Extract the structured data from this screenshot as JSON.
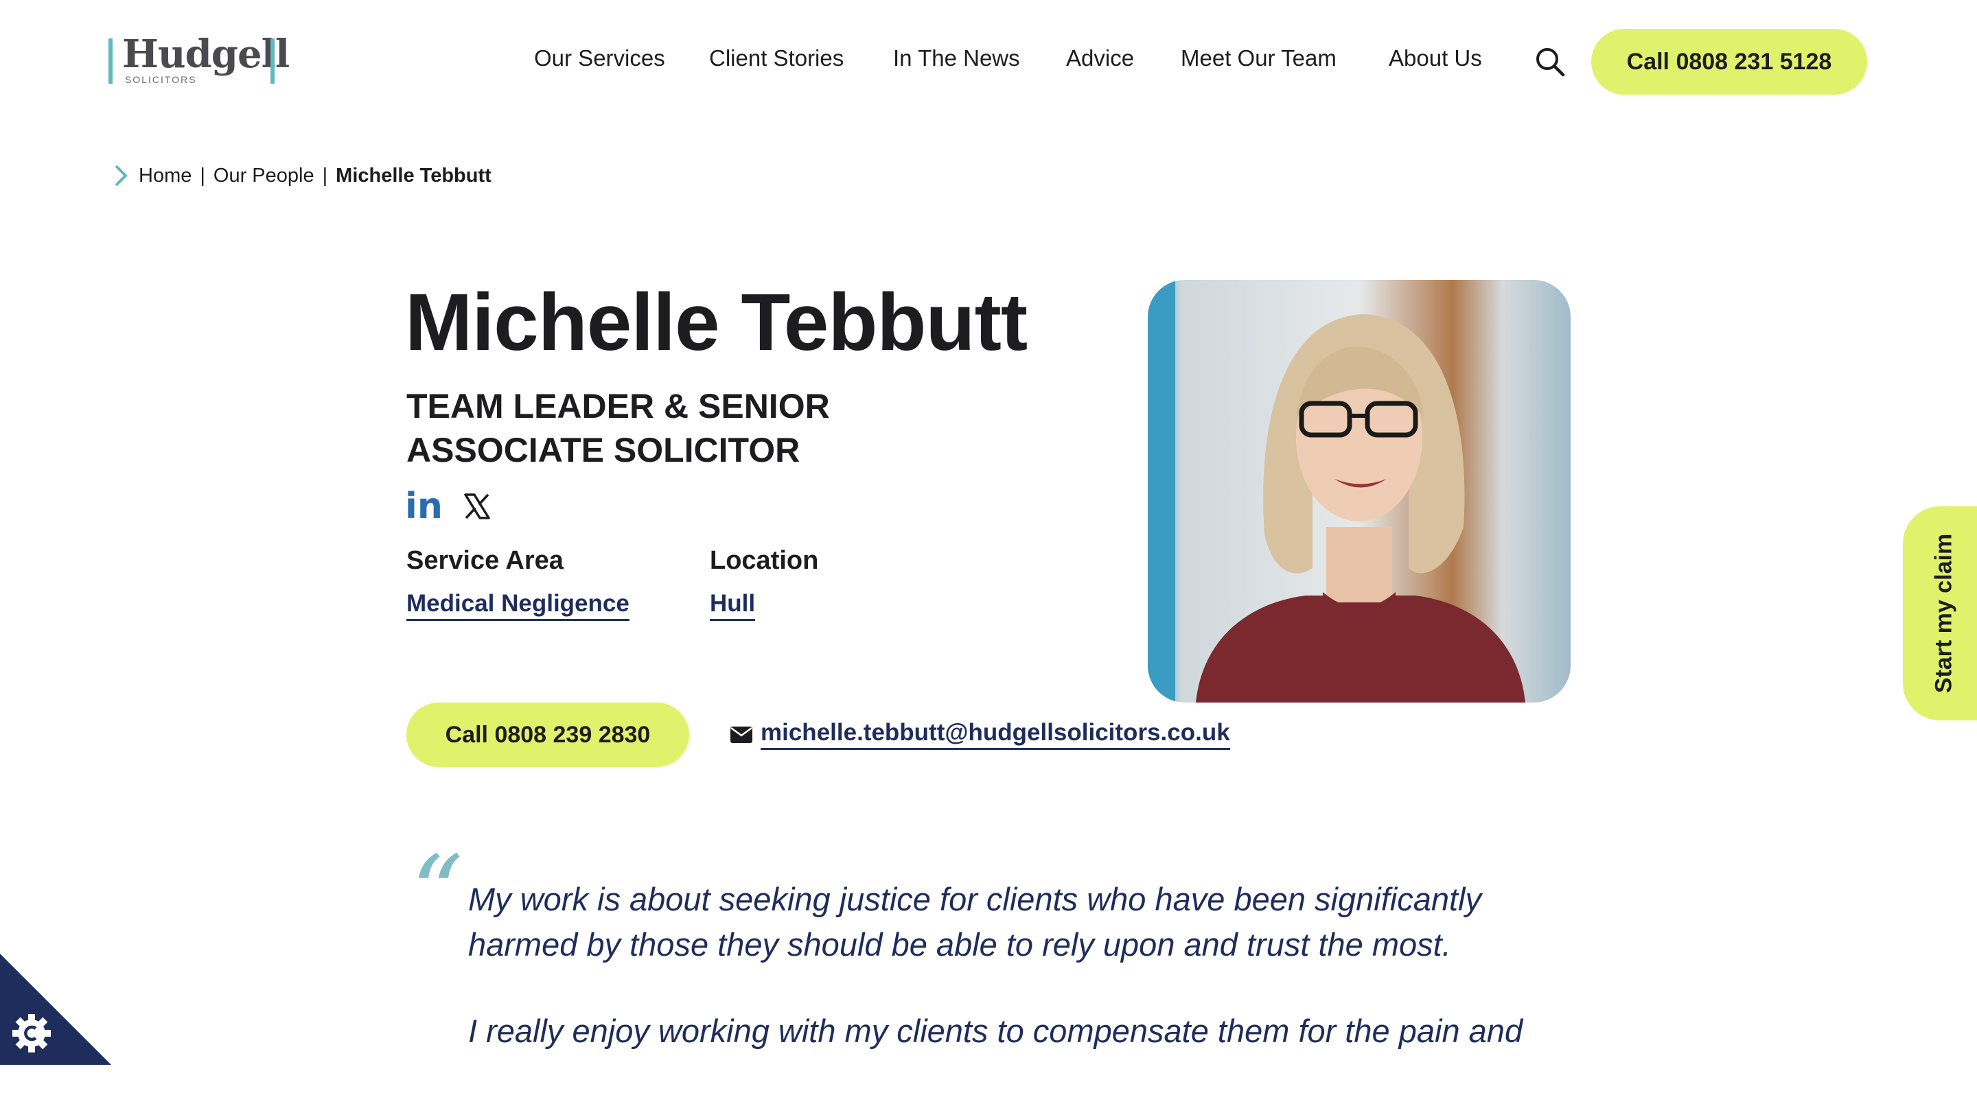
{
  "brand": {
    "name": "Hudgell",
    "subtitle": "SOLICITORS"
  },
  "nav": {
    "items": [
      "Our Services",
      "Client Stories",
      "In The News",
      "Advice",
      "Meet Our Team",
      "About Us"
    ],
    "search_icon": "search-icon",
    "call_label": "Call 0808 231 5128"
  },
  "breadcrumb": {
    "home": "Home",
    "section": "Our People",
    "current": "Michelle Tebbutt",
    "separator": "|"
  },
  "profile": {
    "name": "Michelle Tebbutt",
    "role": "Team Leader & Senior Associate Solicitor",
    "social": {
      "linkedin": "in",
      "x_icon": "x-icon"
    },
    "service_area_label": "Service Area",
    "service_area": "Medical Negligence",
    "location_label": "Location",
    "location": "Hull",
    "call_label": "Call 0808 239 2830",
    "email": "michelle.tebbutt@hudgellsolicitors.co.uk"
  },
  "quote": {
    "mark": "“",
    "paragraph_1": "My work is about seeking justice for clients who have been significantly harmed by those they should be able to rely upon and trust the most.",
    "paragraph_2": "I really enjoy working with my clients to compensate them for the pain and"
  },
  "side_tab": {
    "label": "Start my claim"
  },
  "colors": {
    "accent": "#dff26c",
    "teal": "#5fb8c2",
    "navy": "#1f2d5c",
    "linkedin": "#2b6cb0",
    "cookie": "#1f2d5c"
  }
}
